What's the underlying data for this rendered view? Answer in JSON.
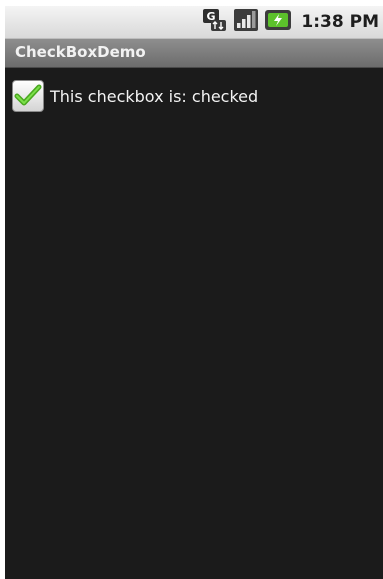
{
  "status_bar": {
    "time": "1:38 PM",
    "icons": [
      "data-transfer-icon",
      "signal-strength-icon",
      "battery-charging-icon"
    ]
  },
  "title_bar": {
    "title": "CheckBoxDemo"
  },
  "checkbox": {
    "checked": true,
    "label": "This checkbox is: checked",
    "check_color": "#5cc12b"
  },
  "theme": {
    "background": "#1b1b1b",
    "text": "#f2f2f2"
  }
}
